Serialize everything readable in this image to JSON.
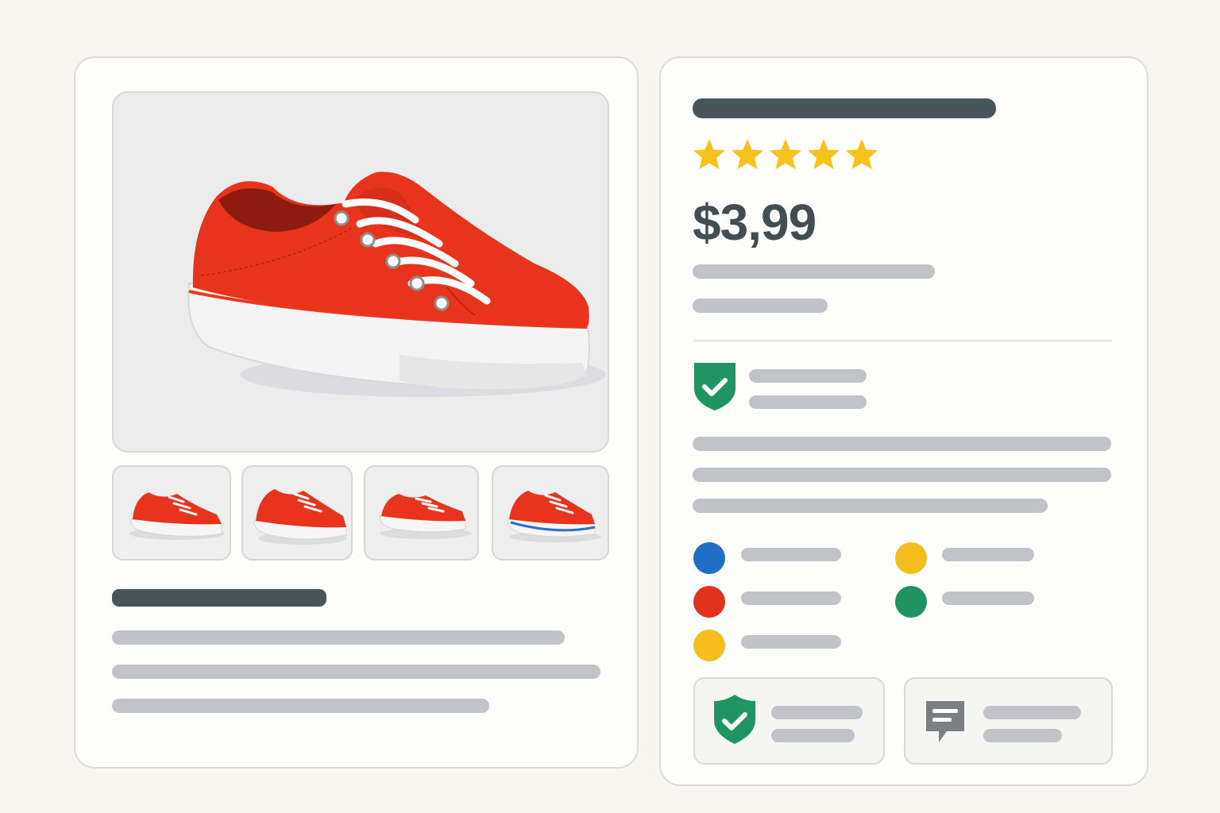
{
  "product": {
    "price": "$3,99",
    "rating": 5,
    "rating_max": 5
  },
  "thumbnails": [
    {
      "icon": "shoe-thumbnail-1"
    },
    {
      "icon": "shoe-thumbnail-2"
    },
    {
      "icon": "shoe-thumbnail-3"
    },
    {
      "icon": "shoe-thumbnail-4"
    }
  ],
  "colors": {
    "shoe": "#e8341c",
    "star": "#f7c21c",
    "shield": "#219463",
    "swatches": [
      "#1e6fc4",
      "#f4bf1c",
      "#e2321d",
      "#1f9462",
      "#f4bf1c"
    ],
    "placeholder_bar": "#c2c3c9",
    "heading_bar": "#48555b"
  },
  "icons": {
    "guarantee": "shield-check-icon",
    "secure": "shield-check-icon",
    "reviews": "chat-bubble-icon",
    "rating": "star-icon"
  }
}
